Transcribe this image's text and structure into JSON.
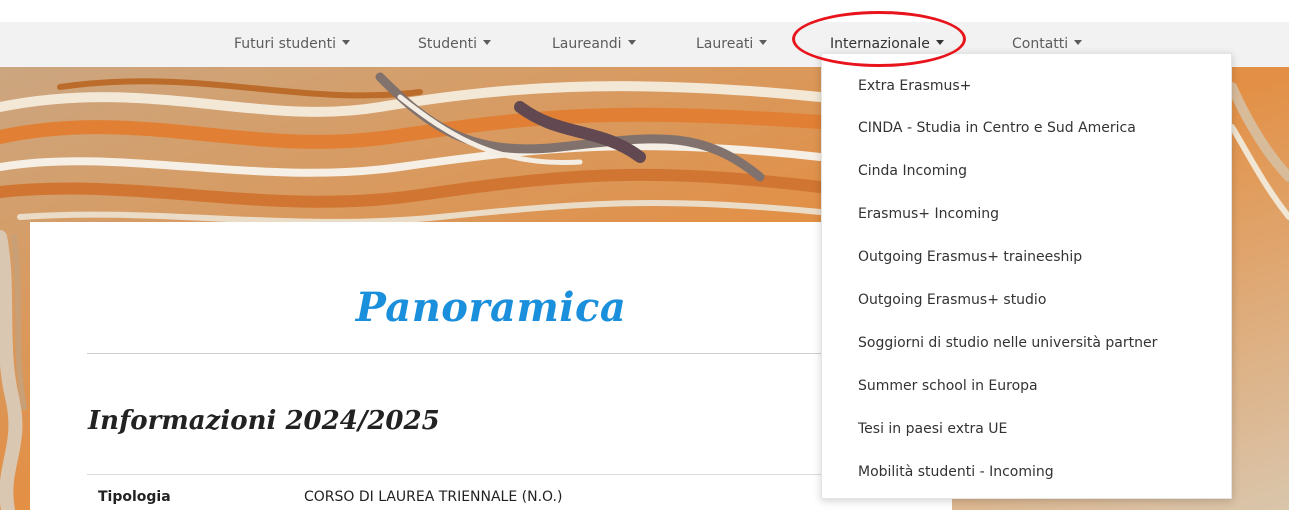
{
  "nav": {
    "items": [
      {
        "label": "Futuri studenti"
      },
      {
        "label": "Studenti"
      },
      {
        "label": "Laureandi"
      },
      {
        "label": "Laureati"
      },
      {
        "label": "Internazionale"
      },
      {
        "label": "Contatti"
      }
    ],
    "active": "Internazionale"
  },
  "annotation": {
    "color": "#e8141b"
  },
  "dropdown": {
    "items": [
      {
        "label": "Extra Erasmus+"
      },
      {
        "label": "CINDA - Studia in Centro e Sud America"
      },
      {
        "label": "Cinda Incoming"
      },
      {
        "label": "Erasmus+ Incoming"
      },
      {
        "label": "Outgoing Erasmus+ traineeship"
      },
      {
        "label": "Outgoing Erasmus+ studio"
      },
      {
        "label": "Soggiorni di studio nelle università partner"
      },
      {
        "label": "Summer school in Europa"
      },
      {
        "label": "Tesi in paesi extra UE"
      },
      {
        "label": "Mobilità studenti - Incoming"
      }
    ]
  },
  "page": {
    "title": "Panoramica",
    "section_title": "Informazioni 2024/2025",
    "info": {
      "label": "Tipologia",
      "value": "CORSO DI LAUREA TRIENNALE (N.O.)"
    }
  },
  "colors": {
    "title_blue": "#1a8fdc",
    "nav_bg": "#f2f2f2",
    "hero_orange": "#e8893a"
  }
}
